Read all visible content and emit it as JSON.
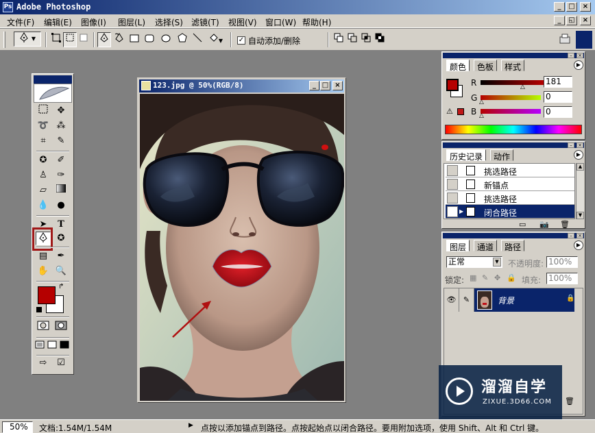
{
  "window": {
    "title": "Adobe Photoshop",
    "app_icon": "photoshop-icon"
  },
  "menubar": {
    "items": [
      "文件(F)",
      "编辑(E)",
      "图像(I)",
      "图层(L)",
      "选择(S)",
      "滤镜(T)",
      "视图(V)",
      "窗口(W)",
      "帮助(H)"
    ]
  },
  "options": {
    "auto_add_delete_label": "自动添加/删除",
    "auto_add_delete_checked": true
  },
  "document": {
    "title": "123.jpg @ 50%(RGB/8)"
  },
  "color_palette": {
    "tabs": [
      "颜色",
      "色板",
      "样式"
    ],
    "active_tab": "颜色",
    "channels": [
      {
        "label": "R",
        "value": "181"
      },
      {
        "label": "G",
        "value": "0"
      },
      {
        "label": "B",
        "value": "0"
      }
    ],
    "foreground_color": "#b50000"
  },
  "history_palette": {
    "tabs": [
      "历史记录",
      "动作"
    ],
    "active_tab": "历史记录",
    "items": [
      {
        "label": "挑选路径",
        "selected": false
      },
      {
        "label": "新锚点",
        "selected": false
      },
      {
        "label": "挑选路径",
        "selected": false
      },
      {
        "label": "闭合路径",
        "selected": true
      }
    ]
  },
  "layers_palette": {
    "tabs": [
      "图层",
      "通道",
      "路径"
    ],
    "active_tab": "图层",
    "blend_mode": "正常",
    "opacity_label": "不透明度:",
    "opacity_value": "100%",
    "lock_label": "锁定:",
    "fill_label": "填充:",
    "fill_value": "100%",
    "layers": [
      {
        "name": "背景",
        "visible": true,
        "locked": true,
        "selected": true
      }
    ]
  },
  "toolbox": {
    "active_tool": "pen-tool",
    "foreground_color": "#b50000",
    "background_color": "#ffffff"
  },
  "statusbar": {
    "zoom": "50%",
    "doc_info": "文档:1.54M/1.54M",
    "hint": "点按以添加锚点到路径。点按起始点以闭合路径。要用附加选项，使用 Shift、Alt 和 Ctrl 键。"
  },
  "watermark": {
    "brand": "溜溜自学",
    "url": "ZIXUE.3D66.COM"
  },
  "colors": {
    "titlebar_start": "#0a246a",
    "titlebar_end": "#a6caf0",
    "chrome": "#d4d0c8",
    "workspace": "#808080",
    "lip_red": "#c01018",
    "annotation_red": "#b01010"
  }
}
